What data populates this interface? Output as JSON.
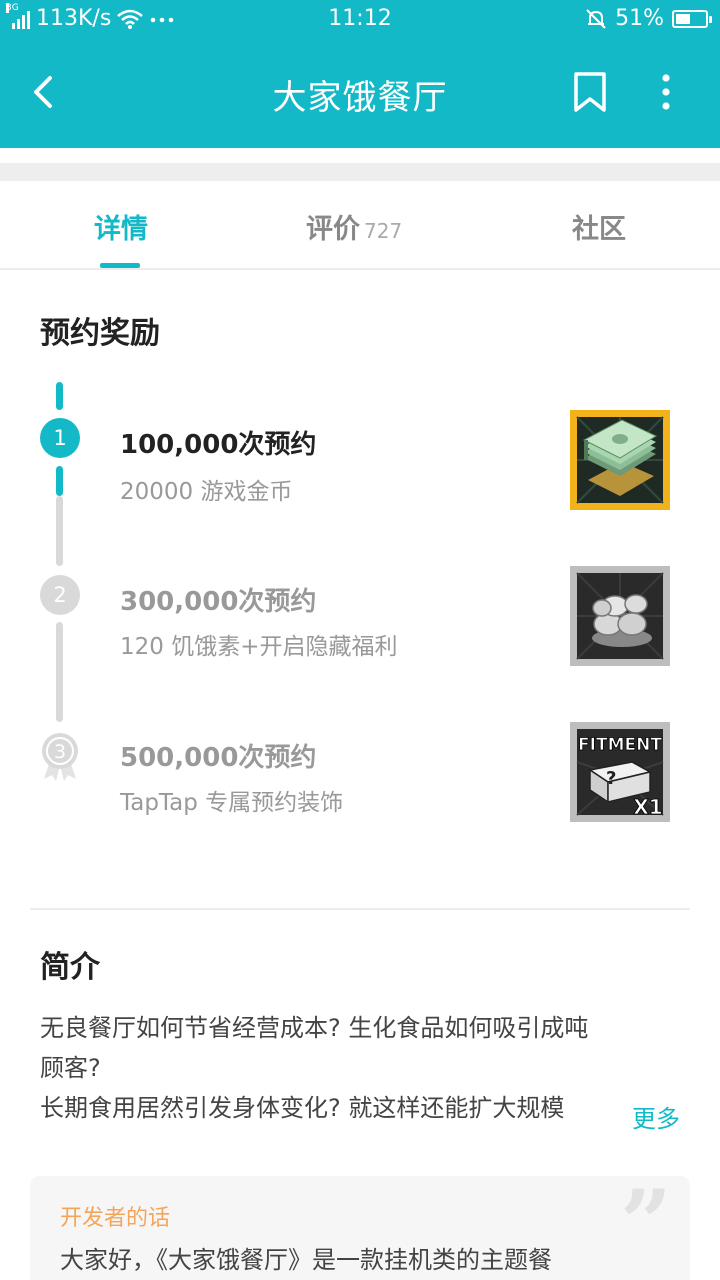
{
  "status_bar": {
    "network_type": "3G",
    "speed": "113K/s",
    "time": "11:12",
    "battery_percent": "51%",
    "battery_level": 0.51
  },
  "app_bar": {
    "title": "大家饿餐厅"
  },
  "tabs": [
    {
      "label": "详情",
      "count": "",
      "active": true
    },
    {
      "label": "评价",
      "count": "727",
      "active": false
    },
    {
      "label": "社区",
      "count": "",
      "active": false
    }
  ],
  "rewards": {
    "heading": "预约奖励",
    "items": [
      {
        "step": "1",
        "title": "100,000次预约",
        "desc": "20000 游戏金币",
        "reached": true,
        "icon": "cash-stack-icon"
      },
      {
        "step": "2",
        "title": "300,000次预约",
        "desc": "120 饥饿素+开启隐藏福利",
        "reached": false,
        "icon": "silver-items-icon"
      },
      {
        "step": "3",
        "title": "500,000次预约",
        "desc": "TapTap 专属预约装饰",
        "reached": false,
        "icon": "fitment-box-icon"
      }
    ],
    "fitment_badge": "FITMENT",
    "fitment_count": "X1"
  },
  "intro": {
    "heading": "简介",
    "lines": [
      "无良餐厅如何节省经营成本? 生化食品如何吸引成吨",
      "顾客?",
      "长期食用居然引发身体变化? 就这样还能扩大规模"
    ],
    "more_label": "更多"
  },
  "developer": {
    "label": "开发者的话",
    "text": "大家好，《大家饿餐厅》是一款挂机类的主题餐"
  },
  "colors": {
    "accent": "#14b9c8",
    "inactive": "#d9d9d9",
    "developer_label": "#f5a55a"
  }
}
